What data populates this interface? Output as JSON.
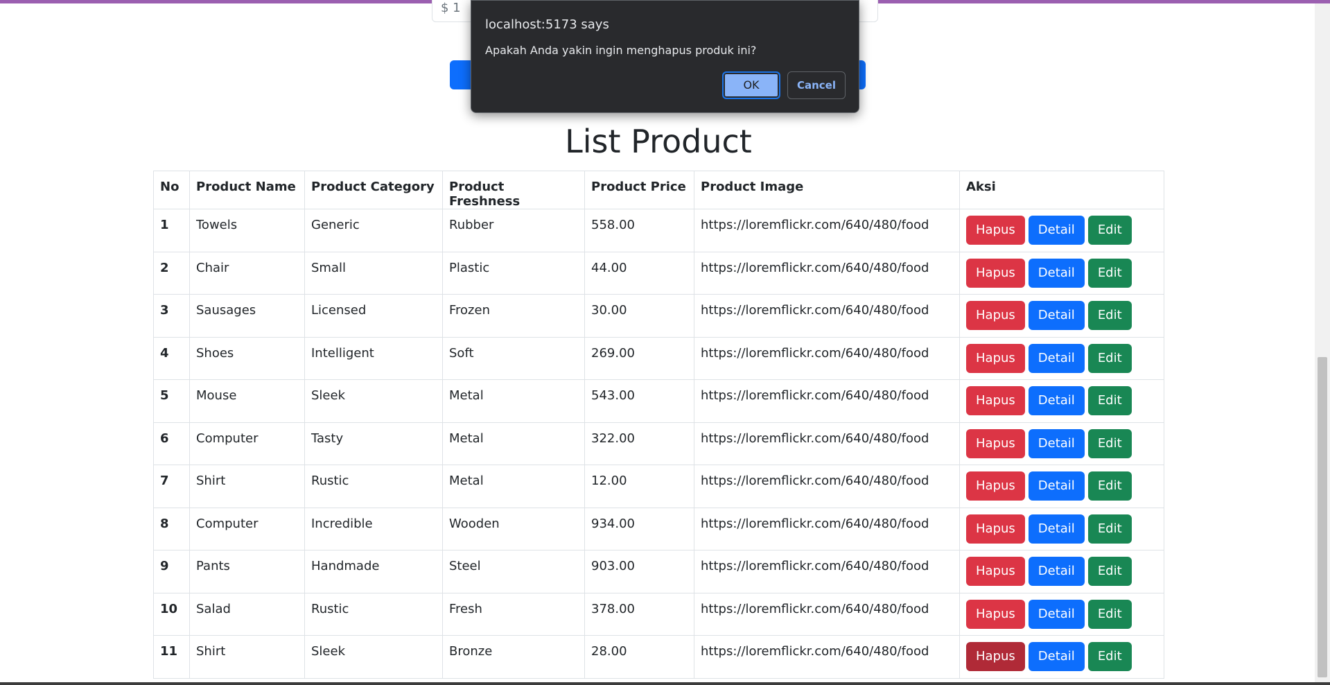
{
  "form": {
    "price_value": "$ 1"
  },
  "page_title": "List Product",
  "table": {
    "headers": [
      "No",
      "Product Name",
      "Product Category",
      "Product Freshness",
      "Product Price",
      "Product Image",
      "Aksi"
    ],
    "rows": [
      {
        "no": "1",
        "name": "Towels",
        "category": "Generic",
        "freshness": "Rubber",
        "price": "558.00",
        "image": "https://loremflickr.com/640/480/food"
      },
      {
        "no": "2",
        "name": "Chair",
        "category": "Small",
        "freshness": "Plastic",
        "price": "44.00",
        "image": "https://loremflickr.com/640/480/food"
      },
      {
        "no": "3",
        "name": "Sausages",
        "category": "Licensed",
        "freshness": "Frozen",
        "price": "30.00",
        "image": "https://loremflickr.com/640/480/food"
      },
      {
        "no": "4",
        "name": "Shoes",
        "category": "Intelligent",
        "freshness": "Soft",
        "price": "269.00",
        "image": "https://loremflickr.com/640/480/food"
      },
      {
        "no": "5",
        "name": "Mouse",
        "category": "Sleek",
        "freshness": "Metal",
        "price": "543.00",
        "image": "https://loremflickr.com/640/480/food"
      },
      {
        "no": "6",
        "name": "Computer",
        "category": "Tasty",
        "freshness": "Metal",
        "price": "322.00",
        "image": "https://loremflickr.com/640/480/food"
      },
      {
        "no": "7",
        "name": "Shirt",
        "category": "Rustic",
        "freshness": "Metal",
        "price": "12.00",
        "image": "https://loremflickr.com/640/480/food"
      },
      {
        "no": "8",
        "name": "Computer",
        "category": "Incredible",
        "freshness": "Wooden",
        "price": "934.00",
        "image": "https://loremflickr.com/640/480/food"
      },
      {
        "no": "9",
        "name": "Pants",
        "category": "Handmade",
        "freshness": "Steel",
        "price": "903.00",
        "image": "https://loremflickr.com/640/480/food"
      },
      {
        "no": "10",
        "name": "Salad",
        "category": "Rustic",
        "freshness": "Fresh",
        "price": "378.00",
        "image": "https://loremflickr.com/640/480/food"
      },
      {
        "no": "11",
        "name": "Shirt",
        "category": "Sleek",
        "freshness": "Bronze",
        "price": "28.00",
        "image": "https://loremflickr.com/640/480/food"
      }
    ],
    "actions": {
      "delete_label": "Hapus",
      "detail_label": "Detail",
      "edit_label": "Edit"
    },
    "active_delete_row": 11
  },
  "dialog": {
    "title": "localhost:5173 says",
    "message": "Apakah Anda yakin ingin menghapus produk ini?",
    "ok_label": "OK",
    "cancel_label": "Cancel"
  },
  "colors": {
    "accent": "#9b5fb0",
    "danger": "#dc3545",
    "primary": "#0d6efd",
    "success": "#198754",
    "dialog_bg": "#292a2d"
  }
}
